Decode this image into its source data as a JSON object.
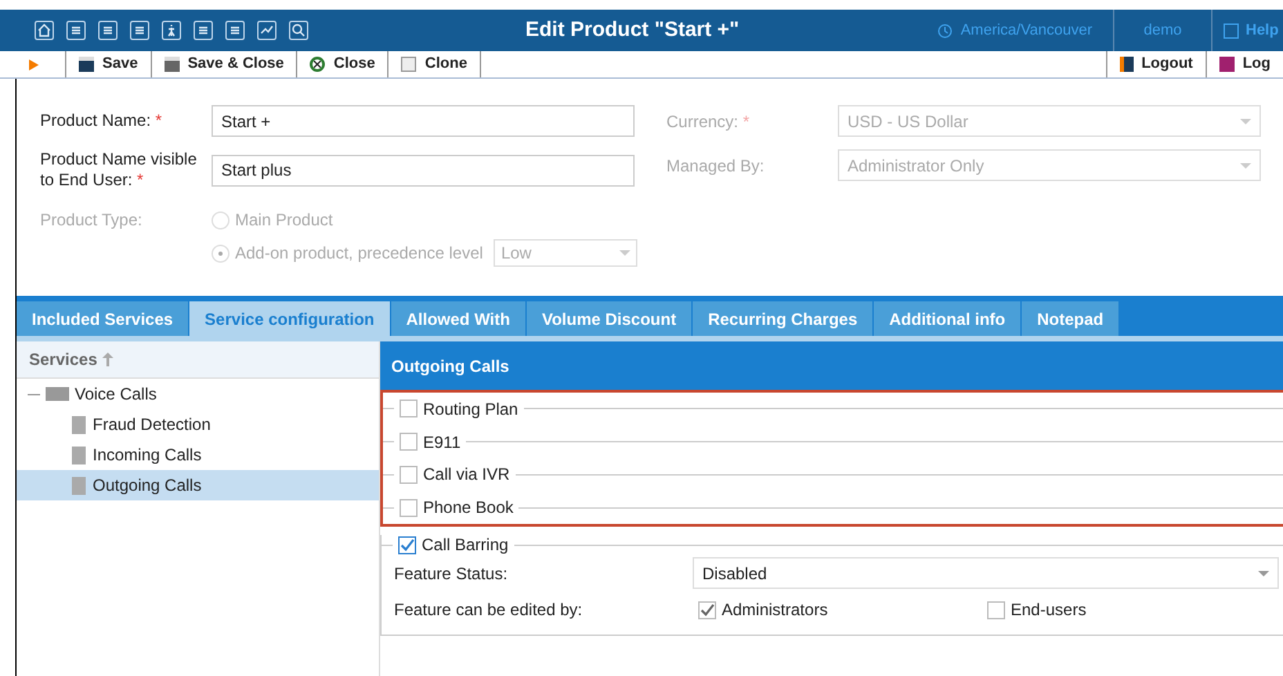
{
  "header": {
    "title": "Edit Product \"Start +\"",
    "timezone": "America/Vancouver",
    "user": "demo",
    "help": "Help"
  },
  "actions": [
    {
      "label": "Save"
    },
    {
      "label": "Save & Close"
    },
    {
      "label": "Close"
    },
    {
      "label": "Clone"
    }
  ],
  "right_actions": [
    {
      "label": "Logout"
    },
    {
      "label": "Log"
    }
  ],
  "form_left": [
    {
      "label": "Product Name:",
      "required_mark": "*",
      "value": "Start +"
    },
    {
      "label": "Product Name visible to End User:",
      "required_mark": "*",
      "value": "Start plus"
    }
  ],
  "form_right": [
    {
      "label": "Currency:",
      "required_mark": "*",
      "value": "USD - US Dollar",
      "disabled": true
    },
    {
      "label": "Managed By:",
      "value": "Administrator Only",
      "disabled": true
    }
  ],
  "product_type": {
    "label": "Product Type:",
    "disabled": true,
    "options": [
      {
        "label": "Main Product",
        "selected": false
      },
      {
        "label": "Add-on product, precedence level",
        "selected": true
      }
    ],
    "precedence": "Low"
  },
  "tabs": [
    {
      "label": "Included Services",
      "selected": false
    },
    {
      "label": "Service configuration",
      "selected": true
    },
    {
      "label": "Allowed With",
      "selected": false
    },
    {
      "label": "Volume Discount",
      "selected": false
    },
    {
      "label": "Recurring Charges",
      "selected": false
    },
    {
      "label": "Additional info",
      "selected": false
    },
    {
      "label": "Notepad",
      "selected": false
    }
  ],
  "tree": {
    "header": "Services",
    "items": [
      {
        "label": "Voice Calls",
        "expanded": true,
        "children": [
          {
            "label": "Fraud Detection",
            "selected": false
          },
          {
            "label": "Incoming Calls",
            "selected": false
          },
          {
            "label": "Outgoing Calls",
            "selected": true
          }
        ]
      }
    ]
  },
  "panel": {
    "title": "Outgoing Calls",
    "features": [
      {
        "label": "Routing Plan",
        "checked": false
      },
      {
        "label": "E911",
        "checked": false
      },
      {
        "label": "Call via IVR",
        "checked": false
      },
      {
        "label": "Phone Book",
        "checked": false
      }
    ],
    "call_barring": {
      "label": "Call Barring",
      "checked": true,
      "status_label": "Feature Status:",
      "status_value": "Disabled",
      "editors_label": "Feature can be edited by:",
      "editors": [
        {
          "label": "Administrators",
          "checked": true
        },
        {
          "label": "End-users",
          "checked": false
        }
      ]
    }
  }
}
